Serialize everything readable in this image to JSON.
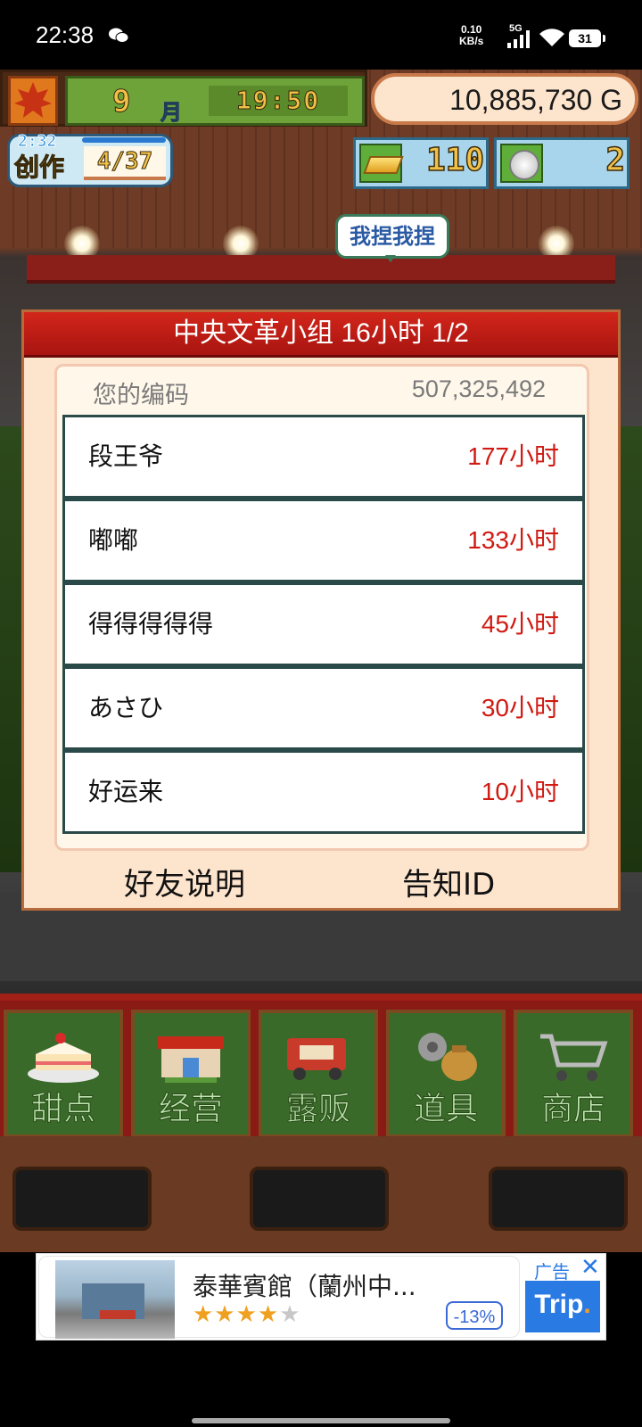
{
  "status_bar": {
    "time": "22:38",
    "net_speed_value": "0.10",
    "net_speed_unit": "KB/s",
    "network_type": "5G",
    "battery": "31"
  },
  "hud": {
    "month_value": "9",
    "month_unit": "月",
    "clock": "19:50",
    "money": "10,885,730 G",
    "create_timer": "2:32",
    "create_label": "创作",
    "create_count": "4/37",
    "gold_count": "110",
    "coin_count": "2",
    "bubble_text": "我捏我捏"
  },
  "dialog": {
    "title": "中央文革小组  16小时 1/2",
    "code_label": "您的编码",
    "code_value": "507,325,492",
    "friends": [
      {
        "name": "段王爷",
        "hours": "177小时"
      },
      {
        "name": "嘟嘟",
        "hours": "133小时"
      },
      {
        "name": "得得得得得",
        "hours": "45小时"
      },
      {
        "name": "あさひ",
        "hours": "30小时"
      },
      {
        "name": "好运来",
        "hours": "10小时"
      }
    ],
    "friend_help_button": "好友说明",
    "notify_id_button": "告知ID"
  },
  "nav": {
    "items": [
      {
        "label": "甜点",
        "icon": "cake-icon"
      },
      {
        "label": "经营",
        "icon": "shop-building-icon"
      },
      {
        "label": "露贩",
        "icon": "food-truck-icon"
      },
      {
        "label": "道具",
        "icon": "gear-bag-icon"
      },
      {
        "label": "商店",
        "icon": "shopping-cart-icon"
      }
    ]
  },
  "ad": {
    "title": "泰華賓館（蘭州中...",
    "rating": 4,
    "rating_max": 5,
    "discount": "-13%",
    "tag": "广告",
    "close": "✕",
    "brand": "Trip",
    "brand_dot": "."
  },
  "colors": {
    "header_red": "#c41e16",
    "hours_red": "#d01a12",
    "panel_bg": "#fde4cc",
    "list_border": "#2a4a4a",
    "nav_green": "#3a6a2a"
  }
}
